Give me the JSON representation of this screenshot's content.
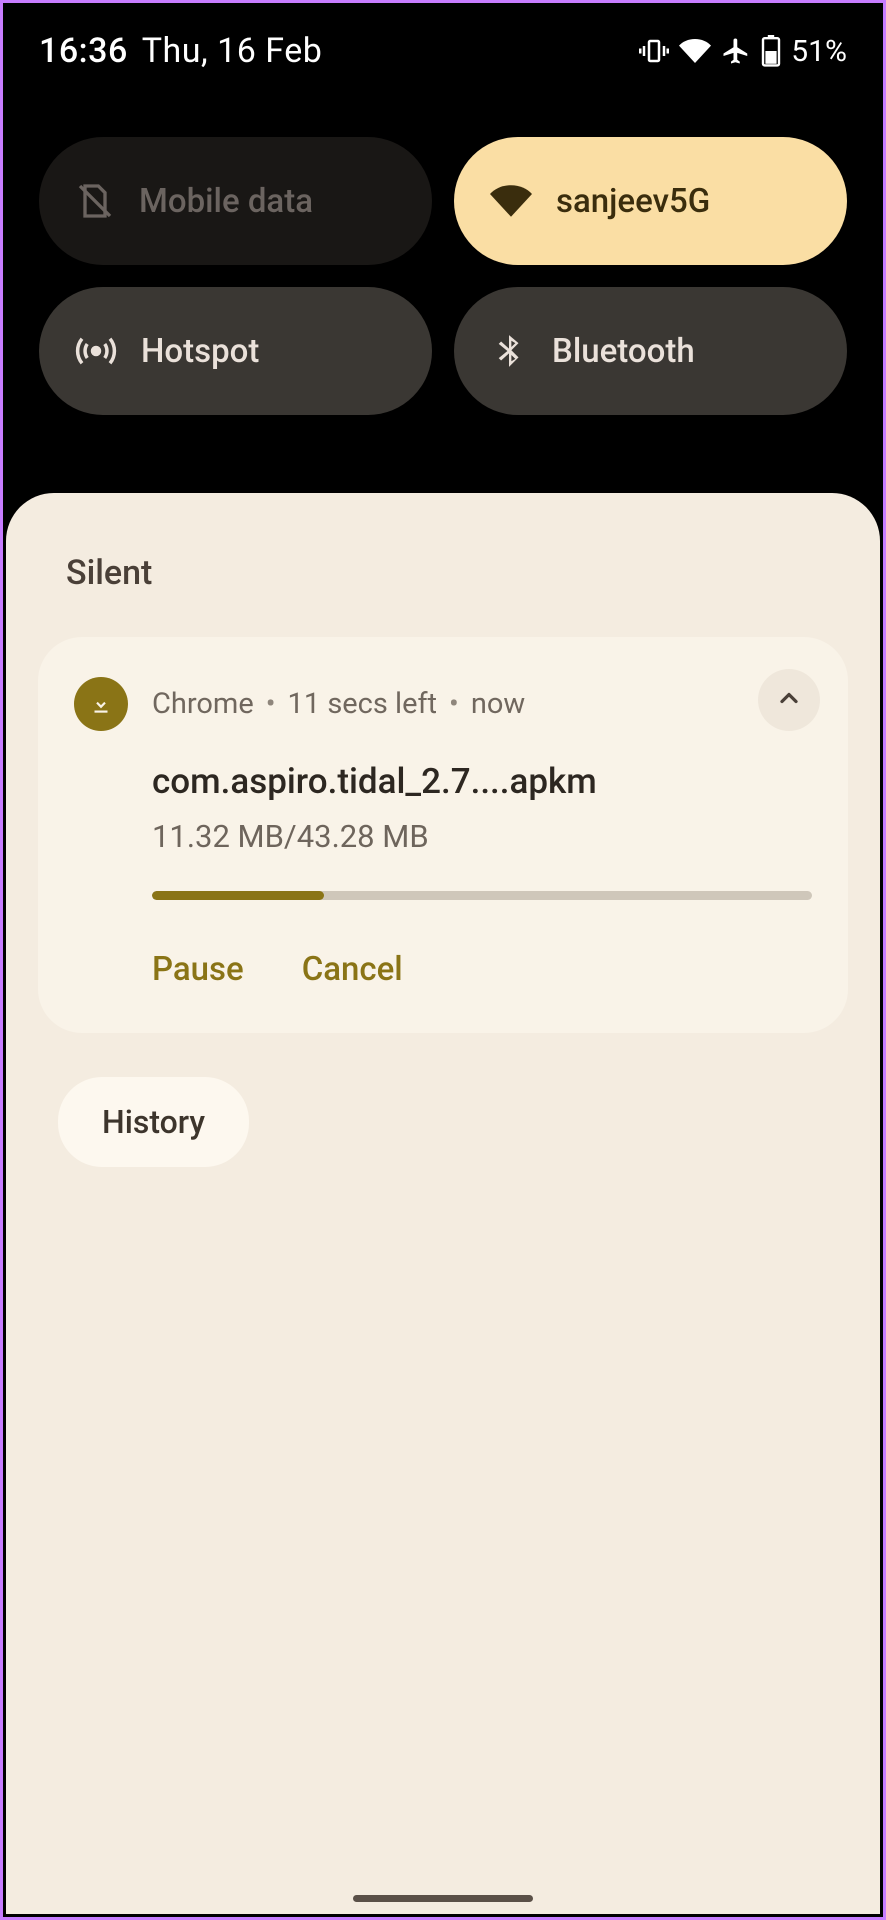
{
  "status": {
    "time": "16:36",
    "date": "Thu, 16 Feb",
    "battery_percent": "51%"
  },
  "tiles": [
    {
      "label": "Mobile data",
      "icon": "sim-off-icon",
      "state": "disabled"
    },
    {
      "label": "sanjeev5G",
      "icon": "wifi-icon",
      "state": "active"
    },
    {
      "label": "Hotspot",
      "icon": "hotspot-icon",
      "state": "inactive"
    },
    {
      "label": "Bluetooth",
      "icon": "bluetooth-icon",
      "state": "inactive"
    }
  ],
  "shade": {
    "section_label": "Silent",
    "notification": {
      "app": "Chrome",
      "time_left": "11 secs left",
      "when": "now",
      "title": "com.aspiro.tidal_2.7....apkm",
      "size_text": "11.32 MB/43.28 MB",
      "progress_percent": 26,
      "actions": {
        "pause": "Pause",
        "cancel": "Cancel"
      }
    },
    "history_label": "History"
  }
}
